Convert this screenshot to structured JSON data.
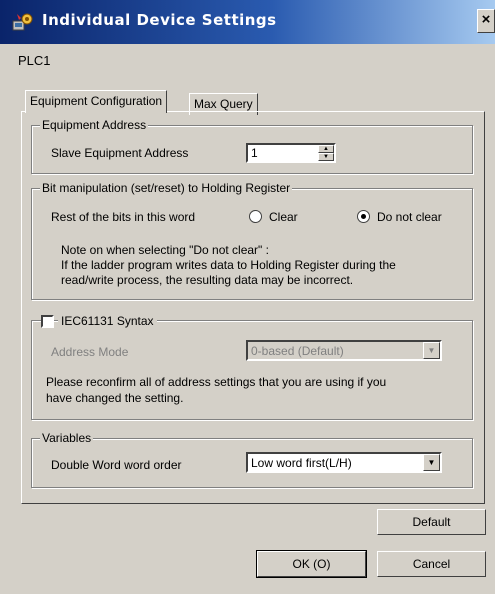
{
  "window": {
    "title": "Individual Device Settings",
    "close_glyph": "×",
    "icon": "device-settings-icon"
  },
  "device_name": "PLC1",
  "tabs": [
    {
      "label": "Equipment Configuration",
      "active": true
    },
    {
      "label": "Max Query",
      "active": false
    }
  ],
  "equipment_address": {
    "group_title": "Equipment Address",
    "slave_label": "Slave Equipment Address",
    "slave_value": "1"
  },
  "bit_manipulation": {
    "group_title": "Bit manipulation (set/reset) to Holding Register",
    "rest_label": "Rest of the bits in this word",
    "option_clear": "Clear",
    "option_do_not_clear": "Do not clear",
    "selected": "Do not clear",
    "note_line1": "Note on when selecting \"Do not clear\" :",
    "note_line2": "If the ladder program writes data to Holding Register during the",
    "note_line3": "read/write process, the resulting data may be incorrect."
  },
  "iec": {
    "checkbox_label": "IEC61131 Syntax",
    "checked": false,
    "address_mode_label": "Address Mode",
    "address_mode_value": "0-based (Default)",
    "reconfirm_line1": "Please reconfirm all of address settings that you are using if you",
    "reconfirm_line2": "have changed the setting."
  },
  "variables": {
    "group_title": "Variables",
    "dword_label": "Double Word word order",
    "dword_value": "Low word first(L/H)"
  },
  "buttons": {
    "default": "Default",
    "ok": "OK (O)",
    "cancel": "Cancel"
  },
  "colors": {
    "titlebar_start": "#0a246a",
    "titlebar_end": "#a6caf0",
    "face": "#d4d0c8"
  }
}
